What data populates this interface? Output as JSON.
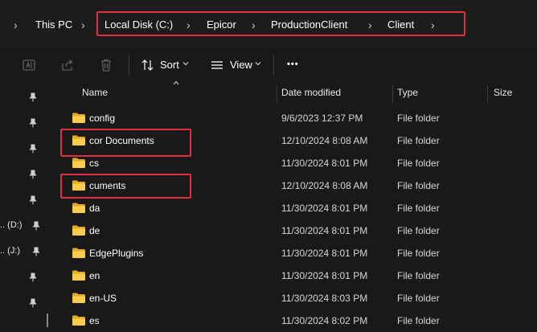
{
  "address_bar": {
    "breadcrumbs": [
      "This PC",
      "Local Disk (C:)",
      "Epicor",
      "ProductionClient",
      "Client"
    ]
  },
  "toolbar": {
    "sort_label": "Sort",
    "view_label": "View",
    "more_label": "•••"
  },
  "sidebar": {
    "drives": [
      ".. (D:)",
      ".. (J:)"
    ]
  },
  "columns": {
    "name": "Name",
    "date_modified": "Date modified",
    "type": "Type",
    "size": "Size"
  },
  "files": [
    {
      "name": "config",
      "date": "9/6/2023 12:37 PM",
      "type": "File folder"
    },
    {
      "name": "cor Documents",
      "date": "12/10/2024 8:08 AM",
      "type": "File folder"
    },
    {
      "name": "cs",
      "date": "11/30/2024 8:01 PM",
      "type": "File folder"
    },
    {
      "name": "cuments",
      "date": "12/10/2024 8:08 AM",
      "type": "File folder"
    },
    {
      "name": "da",
      "date": "11/30/2024 8:01 PM",
      "type": "File folder"
    },
    {
      "name": "de",
      "date": "11/30/2024 8:01 PM",
      "type": "File folder"
    },
    {
      "name": "EdgePlugins",
      "date": "11/30/2024 8:01 PM",
      "type": "File folder"
    },
    {
      "name": "en",
      "date": "11/30/2024 8:01 PM",
      "type": "File folder"
    },
    {
      "name": "en-US",
      "date": "11/30/2024 8:03 PM",
      "type": "File folder"
    },
    {
      "name": "es",
      "date": "11/30/2024 8:02 PM",
      "type": "File folder"
    }
  ],
  "colors": {
    "highlight": "#e0303b",
    "folder": "#f4c542",
    "background": "#191919"
  }
}
